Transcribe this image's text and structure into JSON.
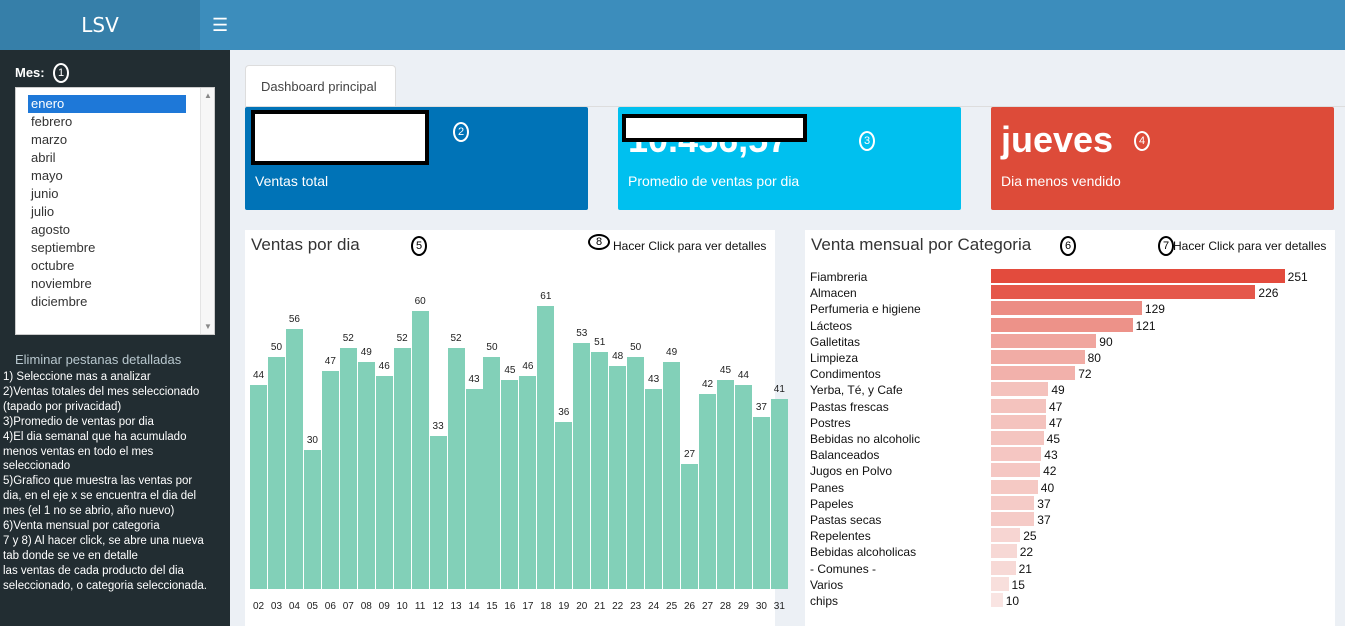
{
  "header": {
    "logo": "LSV",
    "menu_icon": "hamburger-icon"
  },
  "sidebar": {
    "mes_label": "Mes:",
    "months": [
      "enero",
      "febrero",
      "marzo",
      "abril",
      "mayo",
      "junio",
      "julio",
      "agosto",
      "septiembre",
      "octubre",
      "noviembre",
      "diciembre"
    ],
    "selected_month": "enero",
    "eliminar": "Eliminar pestanas detalladas",
    "instructions": [
      "1) Seleccione mas a analizar",
      "2)Ventas totales del mes seleccionado",
      "(tapado por privacidad)",
      "3)Promedio de ventas por dia",
      "4)El dia semanal que ha acumulado",
      "menos ventas en todo el mes",
      "seleccionado",
      "5)Grafico que muestra las ventas por",
      "dia, en el eje x se encuentra el dia del",
      "mes (el 1 no se abrio, año nuevo)",
      "6)Venta mensual por categoria",
      "7 y 8) Al hacer click, se abre una nueva",
      "tab donde se ve en detalle",
      "las ventas de cada producto del dia",
      "seleccionado, o categoria seleccionada."
    ]
  },
  "tab": {
    "label": "Dashboard principal"
  },
  "value_boxes": [
    {
      "value": "",
      "label": "Ventas total",
      "color": "#0073b7"
    },
    {
      "value": "10.456,57",
      "label": "Promedio de ventas por dia",
      "color": "#00c0ef"
    },
    {
      "value": "jueves",
      "label": "Dia menos vendido",
      "color": "#dd4b39"
    }
  ],
  "markers": [
    "1",
    "2",
    "3",
    "4",
    "5",
    "6",
    "7",
    "8"
  ],
  "chart_data": [
    {
      "type": "bar",
      "title": "Ventas por dia",
      "link": "Hacer Click para ver detalles",
      "categories": [
        "02",
        "03",
        "04",
        "05",
        "06",
        "07",
        "08",
        "09",
        "10",
        "11",
        "12",
        "13",
        "14",
        "15",
        "16",
        "17",
        "18",
        "19",
        "20",
        "21",
        "22",
        "23",
        "24",
        "25",
        "26",
        "27",
        "28",
        "29",
        "30",
        "31"
      ],
      "values": [
        44,
        50,
        56,
        30,
        47,
        52,
        49,
        46,
        52,
        60,
        33,
        52,
        43,
        50,
        45,
        46,
        61,
        36,
        53,
        51,
        48,
        50,
        43,
        49,
        27,
        42,
        45,
        44,
        37,
        41
      ],
      "color": "#82d0b8"
    },
    {
      "type": "bar",
      "orientation": "horizontal",
      "title": "Venta mensual por Categoria",
      "link": "Hacer Click para ver detalles",
      "categories": [
        "Fiambreria",
        "Almacen",
        "Perfumeria e higiene",
        "Lácteos",
        "Galletitas",
        "Limpieza",
        "Condimentos",
        "Yerba, Té, y Cafe",
        "Pastas frescas",
        "Postres",
        "Bebidas no alcoholic",
        "Balanceados",
        "Jugos en Polvo",
        "Panes",
        "Papeles",
        "Pastas secas",
        "Repelentes",
        "Bebidas alcoholicas",
        "- Comunes -",
        "Varios",
        "chips"
      ],
      "values": [
        251,
        226,
        129,
        121,
        90,
        80,
        72,
        49,
        47,
        47,
        45,
        43,
        42,
        40,
        37,
        37,
        25,
        22,
        21,
        15,
        10
      ],
      "color_high": "#e34b3d",
      "color_low": "#fbf3f2"
    }
  ]
}
